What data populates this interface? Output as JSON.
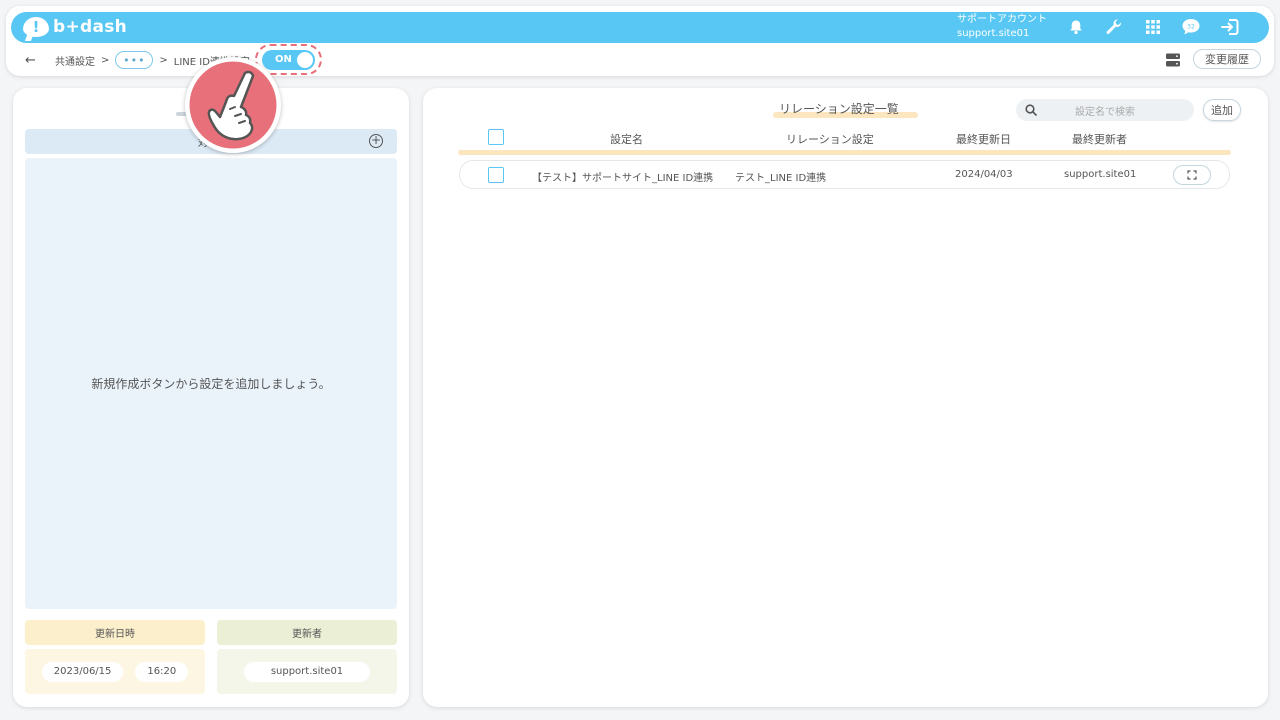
{
  "header": {
    "logo_text": "b+dash",
    "logo_mark": "!",
    "account_label": "サポートアカウント",
    "account_id": "support.site01",
    "icons": [
      "bell-icon",
      "wrench-icon",
      "grid-icon",
      "chat-icon",
      "logout-icon"
    ]
  },
  "breadcrumb": {
    "back": "←",
    "first": "共通設定",
    "sep1": ">",
    "ellipsis": "•••",
    "sep2": ">",
    "current": "LINE ID連携設定",
    "toggle_label": "ON"
  },
  "history_button": "変更履歴",
  "left": {
    "section_label": "対象P",
    "empty_message": "新規作成ボタンから設定を追加しましょう。",
    "updated_at_label": "更新日時",
    "updated_by_label": "更新者",
    "updated_date": "2023/06/15",
    "updated_time": "16:20",
    "updated_user": "support.site01"
  },
  "right": {
    "title": "リレーション設定一覧",
    "search_placeholder": "設定名で検索",
    "add_label": "追加",
    "columns": [
      "設定名",
      "リレーション設定",
      "最終更新日",
      "最終更新者"
    ],
    "rows": [
      {
        "name": "【テスト】サポートサイト_LINE ID連携",
        "relation": "テスト_LINE ID連携",
        "date": "2024/04/03",
        "user": "support.site01"
      }
    ]
  },
  "colors": {
    "accent": "#58c7f3",
    "highlight": "#e8707a",
    "underline": "#fbe6bf"
  }
}
